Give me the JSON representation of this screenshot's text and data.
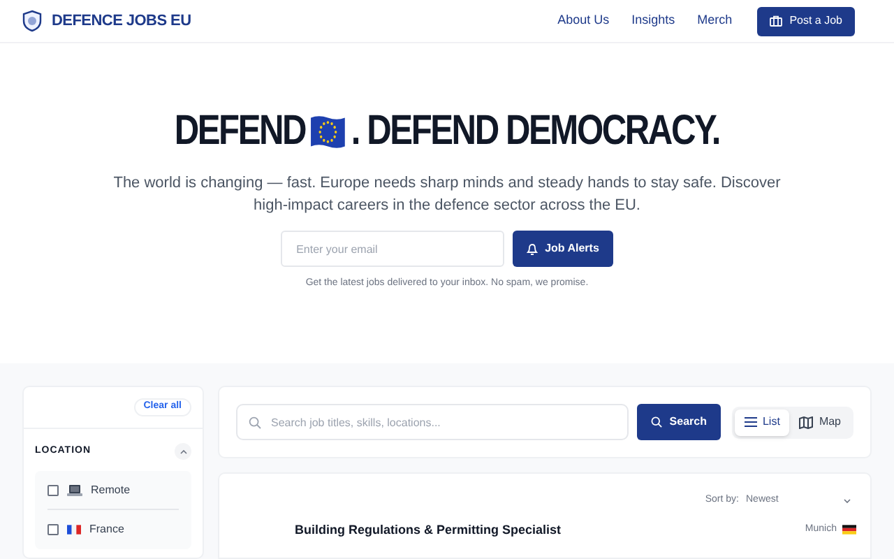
{
  "header": {
    "brand": "DEFENCE JOBS EU",
    "nav": [
      {
        "label": "About Us"
      },
      {
        "label": "Insights"
      },
      {
        "label": "Merch"
      }
    ],
    "cta": "Post a Job"
  },
  "hero": {
    "title_before": "DEFEND",
    "title_after": ". DEFEND DEMOCRACY.",
    "subtitle": "The world is changing — fast. Europe needs sharp minds and steady hands to stay safe. Discover high-impact careers in the defence sector across the EU.",
    "email_placeholder": "Enter your email",
    "alert_button": "Job Alerts",
    "note": "Get the latest jobs delivered to your inbox. No spam, we promise."
  },
  "filters": {
    "clear": "Clear all",
    "section": "LOCATION",
    "expanded": true,
    "options": [
      {
        "label": "Remote",
        "kind": "remote",
        "checked": false
      },
      {
        "label": "France",
        "kind": "france",
        "checked": false
      }
    ]
  },
  "search": {
    "placeholder": "Search job titles, skills, locations...",
    "button": "Search",
    "views": [
      {
        "label": "List",
        "kind": "list",
        "selected": true
      },
      {
        "label": "Map",
        "kind": "map",
        "selected": false
      }
    ]
  },
  "results": {
    "sort_label": "Sort by:",
    "sort_value": "Newest",
    "jobs": [
      {
        "title": "Building Regulations & Permitting Specialist",
        "location": "Munich",
        "kind": "germany"
      }
    ]
  }
}
